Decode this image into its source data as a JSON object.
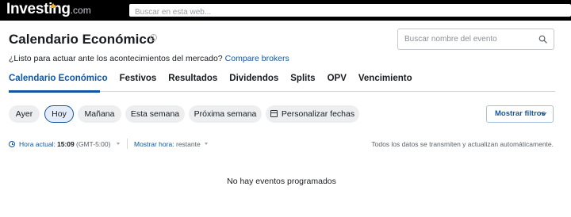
{
  "topbar": {
    "logo_main": "Investing",
    "logo_suffix": ".com",
    "search_placeholder": "Buscar en esta web..."
  },
  "header": {
    "title": "Calendario Económico",
    "info_icon": "info-icon",
    "event_search_placeholder": "Buscar nombre del evento",
    "search_icon": "search-icon",
    "subtitle": "¿Listo para actuar ante los acontecimientos del mercado?",
    "subtitle_link": "Compare brokers"
  },
  "tabs": [
    {
      "label": "Calendario Económico",
      "active": true
    },
    {
      "label": "Festivos",
      "active": false
    },
    {
      "label": "Resultados",
      "active": false
    },
    {
      "label": "Dividendos",
      "active": false
    },
    {
      "label": "Splits",
      "active": false
    },
    {
      "label": "OPV",
      "active": false
    },
    {
      "label": "Vencimiento",
      "active": false
    }
  ],
  "date_filters": [
    {
      "label": "Ayer",
      "active": false
    },
    {
      "label": "Hoy",
      "active": true
    },
    {
      "label": "Mañana",
      "active": false
    },
    {
      "label": "Esta semana",
      "active": false
    },
    {
      "label": "Próxima semana",
      "active": false
    },
    {
      "label": "Personalizar fechas",
      "active": false,
      "icon": "calendar-icon"
    }
  ],
  "filters_button": "Mostrar filtros",
  "time": {
    "current_label": "Hora actual:",
    "current_value": "15:09",
    "timezone": "(GMT-5:00)",
    "show_label": "Mostrar hora:",
    "show_value": "restante",
    "update_note": "Todos los datos se transmiten y actualizan automáticamente."
  },
  "empty_message": "No hay eventos programados",
  "colors": {
    "accent": "#1256a0",
    "topbar": "#000000",
    "pill_bg": "#eceeef",
    "pill_active_bg": "#e3ecf8"
  }
}
